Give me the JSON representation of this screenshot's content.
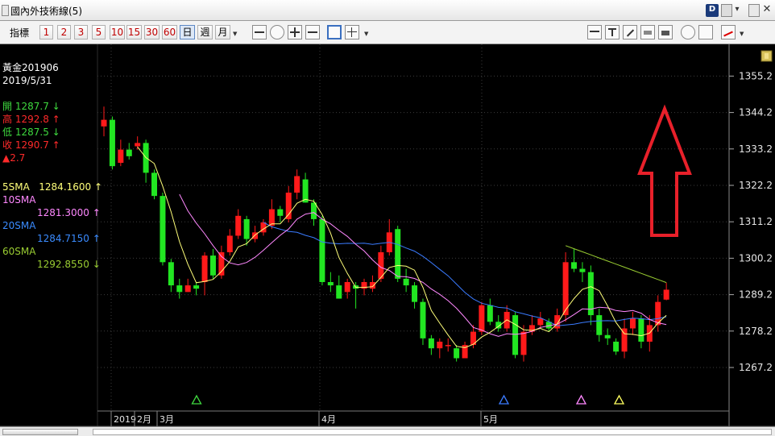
{
  "window": {
    "title": "國內外技術線(5)"
  },
  "toolbar": {
    "indicator_label": "指標",
    "period_buttons": [
      "1",
      "2",
      "3",
      "5",
      "10",
      "15",
      "30",
      "60",
      "日",
      "週",
      "月"
    ]
  },
  "info_panel": {
    "symbol": "黃金201906",
    "date": "2019/5/31",
    "open_label": "開",
    "open_value": "1287.7",
    "high_label": "高",
    "high_value": "1292.8",
    "low_label": "低",
    "low_value": "1287.5",
    "close_label": "收",
    "close_value": "1290.7",
    "change_value": "2.7",
    "sma5_label": "5SMA",
    "sma5_value": "1284.1600",
    "sma10_label": "10SMA",
    "sma10_value": "1281.3000",
    "sma20_label": "20SMA",
    "sma20_value": "1284.7150",
    "sma60_label": "60SMA",
    "sma60_value": "1292.8550"
  },
  "colors": {
    "up": "#ff1a1a",
    "down": "#22e622",
    "sma5": "#ffff7a",
    "sma10": "#ff88ff",
    "sma20": "#3a7bff",
    "sma60": "#9acd32",
    "grid": "#3c3c3c",
    "annotation_arrow": "#e8202a"
  },
  "chart_data": {
    "type": "candlestick",
    "y_ticks": [
      1267.2,
      1278.2,
      1289.2,
      1300.2,
      1311.2,
      1322.2,
      1333.2,
      1344.2,
      1355.2
    ],
    "ylim": [
      1262,
      1361
    ],
    "x_labels": [
      "2019",
      "2月",
      "3月",
      "4月",
      "5月"
    ],
    "candles": [
      [
        1340,
        1346,
        1337,
        1342
      ],
      [
        1342,
        1343,
        1327,
        1328
      ],
      [
        1329,
        1336,
        1328,
        1333
      ],
      [
        1333,
        1335,
        1330,
        1331
      ],
      [
        1334,
        1337,
        1333,
        1335
      ],
      [
        1335,
        1336,
        1323,
        1326
      ],
      [
        1326,
        1327,
        1318,
        1319
      ],
      [
        1319,
        1320,
        1298,
        1299
      ],
      [
        1299,
        1300,
        1290,
        1292
      ],
      [
        1292,
        1294,
        1288,
        1290
      ],
      [
        1290,
        1294,
        1290,
        1292
      ],
      [
        1292,
        1293,
        1289,
        1291
      ],
      [
        1293,
        1302,
        1289,
        1301
      ],
      [
        1301,
        1303,
        1294,
        1295
      ],
      [
        1295,
        1304,
        1294,
        1302
      ],
      [
        1302,
        1309,
        1301,
        1307
      ],
      [
        1307,
        1315,
        1306,
        1313
      ],
      [
        1312,
        1313,
        1304,
        1306
      ],
      [
        1306,
        1310,
        1305,
        1308
      ],
      [
        1308,
        1312,
        1307,
        1311
      ],
      [
        1310,
        1318,
        1309,
        1315
      ],
      [
        1315,
        1316,
        1311,
        1313
      ],
      [
        1312,
        1322,
        1311,
        1320
      ],
      [
        1320,
        1327,
        1318,
        1325
      ],
      [
        1324,
        1326,
        1317,
        1317
      ],
      [
        1317,
        1318,
        1310,
        1312
      ],
      [
        1312,
        1313,
        1292,
        1293
      ],
      [
        1293,
        1296,
        1290,
        1292
      ],
      [
        1292,
        1295,
        1288,
        1288
      ],
      [
        1290,
        1294,
        1288,
        1293
      ],
      [
        1292,
        1293,
        1285,
        1291
      ],
      [
        1291,
        1294,
        1289,
        1293
      ],
      [
        1291,
        1295,
        1290,
        1293
      ],
      [
        1294,
        1304,
        1293,
        1302
      ],
      [
        1302,
        1312,
        1301,
        1308
      ],
      [
        1309,
        1310,
        1293,
        1294
      ],
      [
        1294,
        1297,
        1290,
        1292
      ],
      [
        1292,
        1293,
        1285,
        1287
      ],
      [
        1287,
        1288,
        1274,
        1276
      ],
      [
        1276,
        1277,
        1271,
        1273
      ],
      [
        1273,
        1276,
        1270,
        1275
      ],
      [
        1274,
        1276,
        1272,
        1274
      ],
      [
        1273,
        1274,
        1269,
        1270
      ],
      [
        1270,
        1275,
        1270,
        1274
      ],
      [
        1274,
        1280,
        1273,
        1278
      ],
      [
        1278,
        1287,
        1277,
        1286
      ],
      [
        1286,
        1288,
        1280,
        1281
      ],
      [
        1281,
        1283,
        1278,
        1279
      ],
      [
        1279,
        1286,
        1278,
        1284
      ],
      [
        1283,
        1284,
        1270,
        1271
      ],
      [
        1271,
        1280,
        1269,
        1278
      ],
      [
        1278,
        1283,
        1277,
        1280
      ],
      [
        1280,
        1284,
        1279,
        1282
      ],
      [
        1281,
        1282,
        1278,
        1279
      ],
      [
        1279,
        1285,
        1278,
        1283
      ],
      [
        1283,
        1302,
        1281,
        1299
      ],
      [
        1299,
        1303,
        1296,
        1297
      ],
      [
        1297,
        1299,
        1293,
        1296
      ],
      [
        1296,
        1298,
        1280,
        1283
      ],
      [
        1283,
        1285,
        1275,
        1277
      ],
      [
        1277,
        1279,
        1274,
        1276
      ],
      [
        1275,
        1276,
        1271,
        1272
      ],
      [
        1272,
        1282,
        1270,
        1279
      ],
      [
        1279,
        1284,
        1277,
        1282
      ],
      [
        1282,
        1283,
        1273,
        1275
      ],
      [
        1275,
        1283,
        1272,
        1280
      ],
      [
        1280,
        1289,
        1278,
        1287
      ],
      [
        1287.7,
        1292.8,
        1287.5,
        1290.7
      ]
    ]
  }
}
